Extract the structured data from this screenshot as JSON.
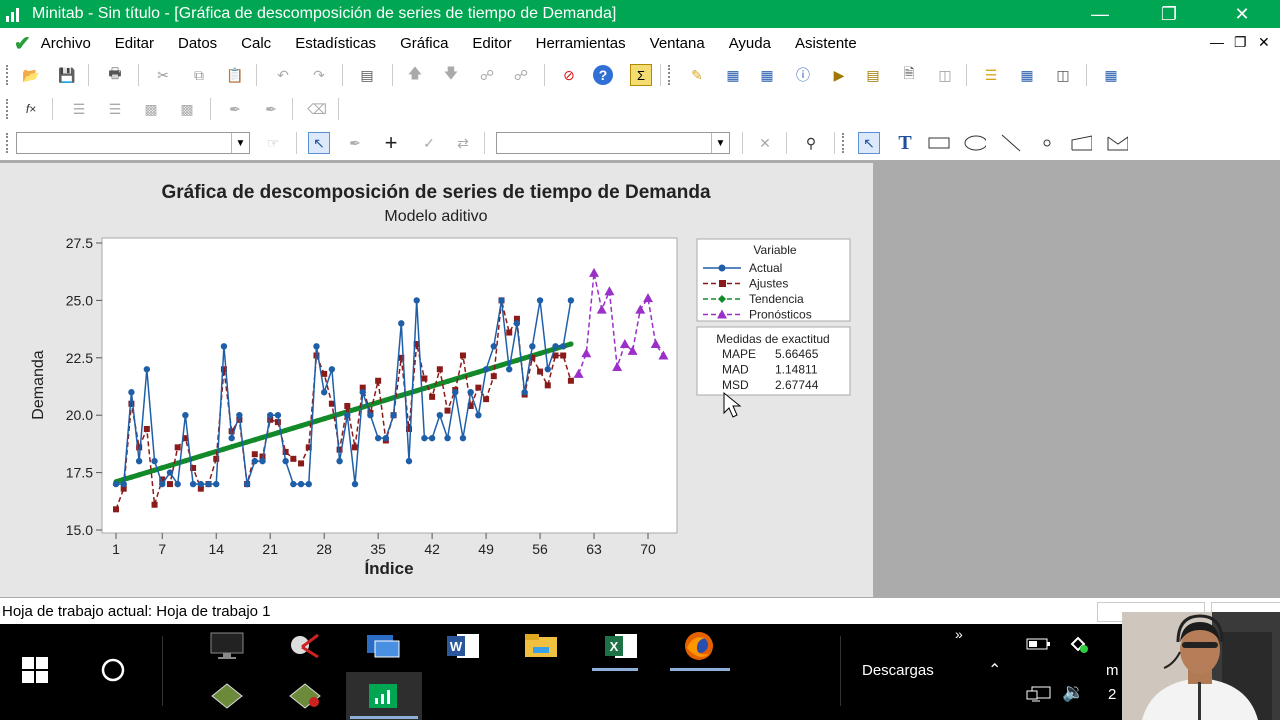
{
  "window": {
    "title": "Minitab - Sin título - [Gráfica de descomposición de series de tiempo de Demanda]"
  },
  "menu": [
    "Archivo",
    "Editar",
    "Datos",
    "Calc",
    "Estadísticas",
    "Gráfica",
    "Editor",
    "Herramientas",
    "Ventana",
    "Ayuda",
    "Asistente"
  ],
  "chart_data": {
    "type": "line",
    "title": "Gráfica de descomposición de series de tiempo de Demanda",
    "subtitle": "Modelo aditivo",
    "xlabel": "Índice",
    "ylabel": "Demanda",
    "ylim": [
      15.0,
      27.5
    ],
    "xlim": [
      0,
      72
    ],
    "yticks": [
      "15.0",
      "17.5",
      "20.0",
      "22.5",
      "25.0",
      "27.5"
    ],
    "xticks": [
      1,
      7,
      14,
      21,
      28,
      35,
      42,
      49,
      56,
      63,
      70
    ],
    "grid": false,
    "legend": {
      "title": "Variable",
      "position": "right",
      "entries": [
        "Actual",
        "Ajustes",
        "Tendencia",
        "Pronósticos"
      ]
    },
    "accuracy": {
      "title": "Medidas de exactitud",
      "rows": [
        [
          "MAPE",
          "5.66465"
        ],
        [
          "MAD",
          "1.14811"
        ],
        [
          "MSD",
          "2.67744"
        ]
      ]
    },
    "colors": {
      "actual": "#1f5fa8",
      "fits": "#8b1a1a",
      "trend": "#128a2a",
      "forecast": "#9b30c8"
    },
    "series": [
      {
        "name": "Actual",
        "x": [
          1,
          2,
          3,
          4,
          5,
          6,
          7,
          8,
          9,
          10,
          11,
          12,
          13,
          14,
          15,
          16,
          17,
          18,
          19,
          20,
          21,
          22,
          23,
          24,
          25,
          26,
          27,
          28,
          29,
          30,
          31,
          32,
          33,
          34,
          35,
          36,
          37,
          38,
          39,
          40,
          41,
          42,
          43,
          44,
          45,
          46,
          47,
          48,
          49,
          50,
          51,
          52,
          53,
          54,
          55,
          56,
          57,
          58,
          59,
          60
        ],
        "values": [
          17.0,
          17.0,
          21.0,
          18.0,
          22.0,
          18.0,
          17.0,
          17.5,
          17.0,
          20.0,
          17.0,
          17.0,
          17.0,
          17.0,
          23.0,
          19.0,
          20.0,
          17.0,
          18.0,
          18.0,
          20.0,
          20.0,
          18.0,
          17.0,
          17.0,
          17.0,
          23.0,
          21.0,
          22.0,
          18.0,
          20.0,
          17.0,
          21.0,
          20.0,
          19.0,
          19.0,
          20.0,
          24.0,
          18.0,
          25.0,
          19.0,
          19.0,
          20.0,
          19.0,
          21.0,
          19.0,
          21.0,
          20.0,
          22.0,
          23.0,
          25.0,
          22.0,
          24.0,
          21.0,
          23.0,
          25.0,
          22.0,
          23.0,
          23.0,
          25.0
        ]
      },
      {
        "name": "Ajustes",
        "x": [
          1,
          2,
          3,
          4,
          5,
          6,
          7,
          8,
          9,
          10,
          11,
          12,
          13,
          14,
          15,
          16,
          17,
          18,
          19,
          20,
          21,
          22,
          23,
          24,
          25,
          26,
          27,
          28,
          29,
          30,
          31,
          32,
          33,
          34,
          35,
          36,
          37,
          38,
          39,
          40,
          41,
          42,
          43,
          44,
          45,
          46,
          47,
          48,
          49,
          50,
          51,
          52,
          53,
          54,
          55,
          56,
          57,
          58,
          59,
          60
        ],
        "values": [
          15.9,
          16.8,
          20.5,
          18.6,
          19.4,
          16.1,
          17.2,
          17.0,
          18.6,
          19.0,
          17.7,
          16.8,
          17.0,
          18.1,
          22.0,
          19.3,
          19.8,
          17.0,
          18.3,
          18.2,
          19.8,
          19.7,
          18.4,
          18.1,
          17.9,
          18.6,
          22.6,
          21.8,
          20.5,
          18.5,
          20.4,
          18.6,
          21.2,
          20.1,
          21.5,
          18.9,
          20.0,
          22.5,
          19.4,
          23.1,
          21.6,
          20.8,
          22.0,
          20.2,
          21.1,
          22.6,
          20.4,
          21.2,
          20.7,
          21.7,
          25.0,
          23.6,
          24.2,
          20.9,
          22.5,
          21.9,
          21.3,
          22.6,
          22.6,
          21.5
        ]
      },
      {
        "name": "Tendencia",
        "x": [
          1,
          60
        ],
        "values": [
          17.1,
          23.1
        ]
      },
      {
        "name": "Pronósticos",
        "x": [
          61,
          62,
          63,
          64,
          65,
          66,
          67,
          68,
          69,
          70,
          71,
          72
        ],
        "values": [
          21.8,
          22.7,
          26.2,
          24.6,
          25.4,
          22.1,
          23.1,
          22.8,
          24.6,
          25.1,
          23.1,
          22.6
        ]
      }
    ]
  },
  "status": {
    "text": "Hoja de trabajo actual: Hoja de trabajo 1"
  },
  "taskbar": {
    "downloads_label": "Descargas",
    "clock_partial_1": "m",
    "clock_partial_2": "2"
  }
}
